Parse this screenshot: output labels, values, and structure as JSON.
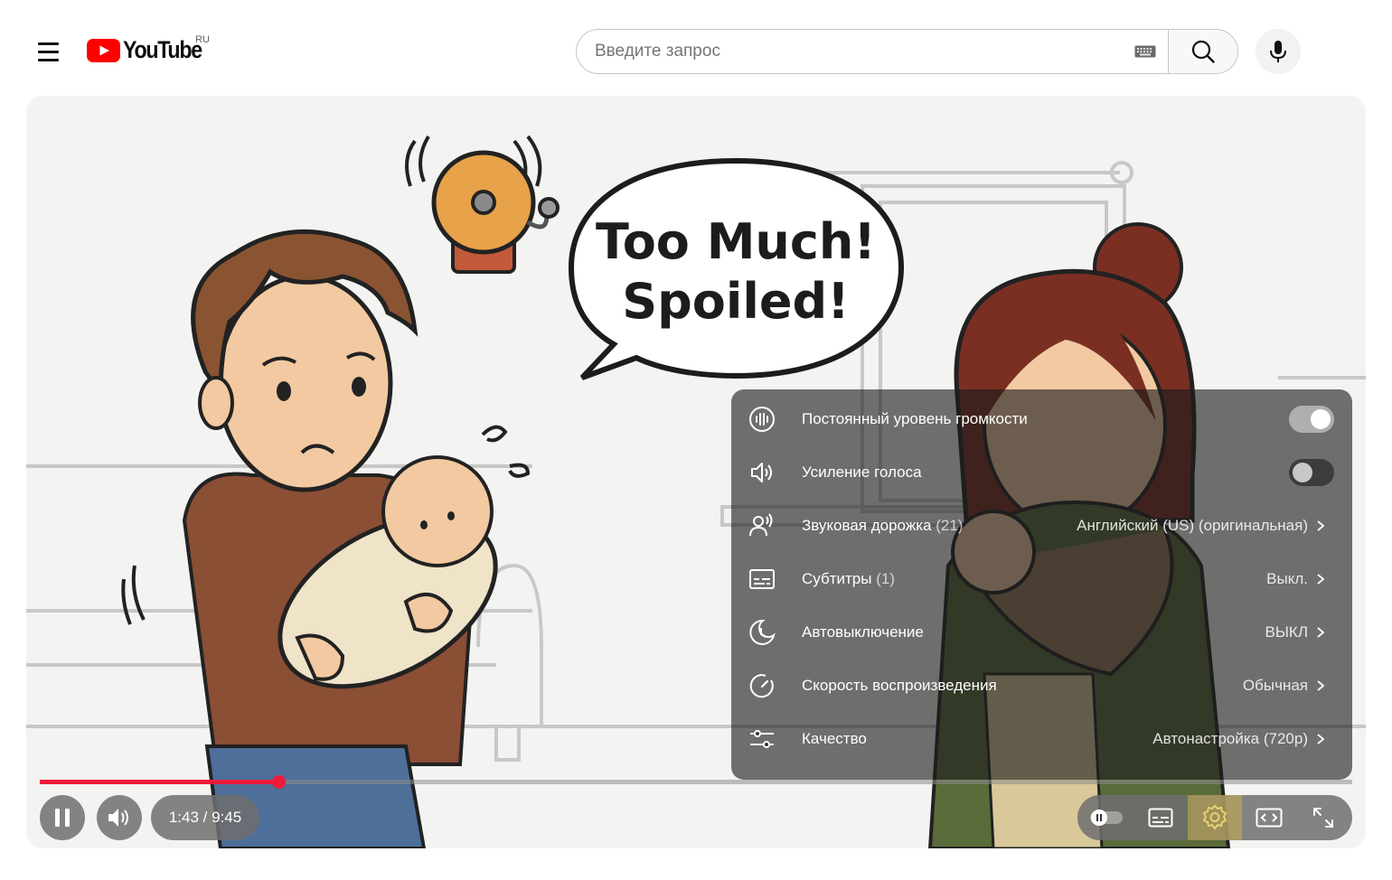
{
  "masthead": {
    "logo_text": "YouTube",
    "country_code": "RU",
    "search_placeholder": "Введите запрос",
    "icons": [
      "menu-icon",
      "keyboard-icon",
      "search-icon",
      "microphone-icon"
    ]
  },
  "video": {
    "speech_line1": "Too Much!",
    "speech_line2": "Spoiled!"
  },
  "settings_menu": {
    "items": [
      {
        "icon": "volume-level-icon",
        "label": "Постоянный уровень громкости",
        "toggle": true
      },
      {
        "icon": "voice-boost-icon",
        "label": "Усиление голоса",
        "toggle": false
      },
      {
        "icon": "audio-track-icon",
        "label": "Звуковая дорожка",
        "count": "(21)",
        "value": "Английский (US) (оригинальная)"
      },
      {
        "icon": "subtitles-icon",
        "label": "Субтитры",
        "count": "(1)",
        "value": "Выкл."
      },
      {
        "icon": "sleep-timer-icon",
        "label": "Автовыключение",
        "value": "ВЫКЛ"
      },
      {
        "icon": "playback-speed-icon",
        "label": "Скорость воспроизведения",
        "value": "Обычная"
      },
      {
        "icon": "quality-icon",
        "label": "Качество",
        "value": "Автонастройка (720p)"
      }
    ]
  },
  "player": {
    "progress_fraction": 0.1817,
    "time_display": "1:43 / 9:45",
    "accent_color": "#f01a3a",
    "controls": [
      "pause-icon",
      "volume-icon",
      "autoplay-toggle-icon",
      "subtitles-icon",
      "settings-gear-icon",
      "theater-mode-icon",
      "fullscreen-icon"
    ]
  }
}
